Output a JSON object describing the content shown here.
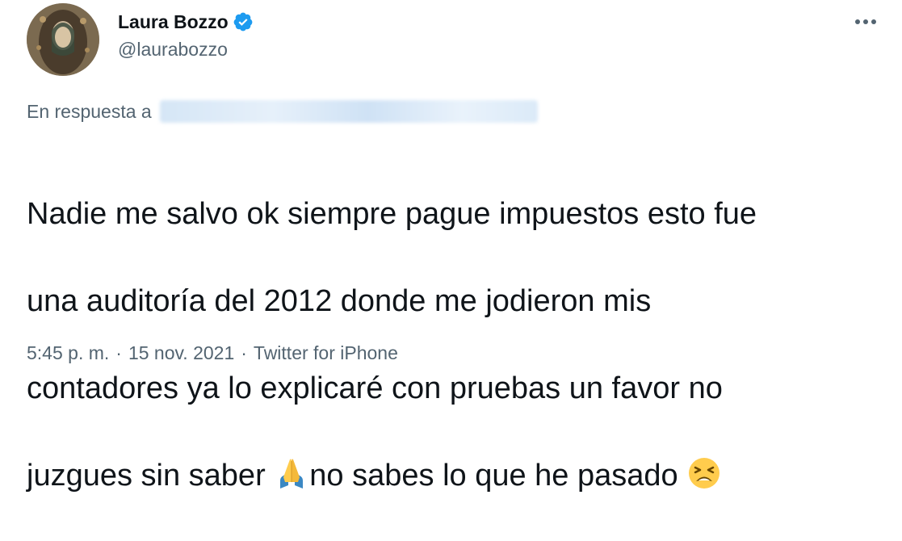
{
  "author": {
    "name": "Laura Bozzo",
    "handle": "@laurabozzo",
    "verified_color": "#1d9bf0"
  },
  "more_icon": "more-horizontal-icon",
  "reply": {
    "prefix": "En respuesta a"
  },
  "tweet": {
    "line1": "Nadie me salvo ok siempre pague impuestos esto fue",
    "line2": "una auditoría del 2012 donde me jodieron mis",
    "line3": "contadores ya lo explicaré con pruebas un favor no",
    "line4_a": "juzgues sin saber ",
    "line4_b": "no sabes lo que he pasado ",
    "emoji1": "folded-hands-emoji",
    "emoji2": "tired-face-emoji"
  },
  "meta": {
    "time": "5:45 p. m.",
    "separator": "·",
    "date": "15 nov. 2021",
    "source": "Twitter for iPhone"
  }
}
